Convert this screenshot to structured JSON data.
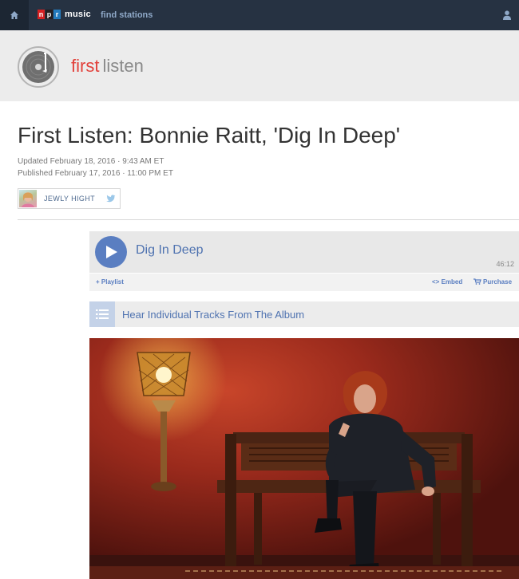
{
  "nav": {
    "home_icon": "home-icon",
    "logo_letters": [
      "n",
      "p",
      "r"
    ],
    "logo_music": "music",
    "find_stations": "find stations",
    "user_icon": "user-icon"
  },
  "banner": {
    "first": "first",
    "listen": "listen"
  },
  "article": {
    "headline": "First Listen: Bonnie Raitt, 'Dig In Deep'",
    "updated": "Updated February 18, 2016 · 9:43 AM ET",
    "published": "Published February 17, 2016 · 11:00 PM ET",
    "author": "JEWLY HIGHT"
  },
  "player": {
    "title": "Dig In Deep",
    "duration": "46:12",
    "playlist": "+ Playlist",
    "embed": "<> Embed",
    "purchase": "Purchase"
  },
  "tracks": {
    "label": "Hear Individual Tracks From The Album"
  },
  "colors": {
    "nav_bg": "#263242",
    "accent_red": "#e2403a",
    "link_blue": "#4e72b0",
    "play_blue": "#5a7ec1",
    "npr_red": "#d62021",
    "npr_black": "#231f20",
    "npr_blue": "#237bbd"
  }
}
